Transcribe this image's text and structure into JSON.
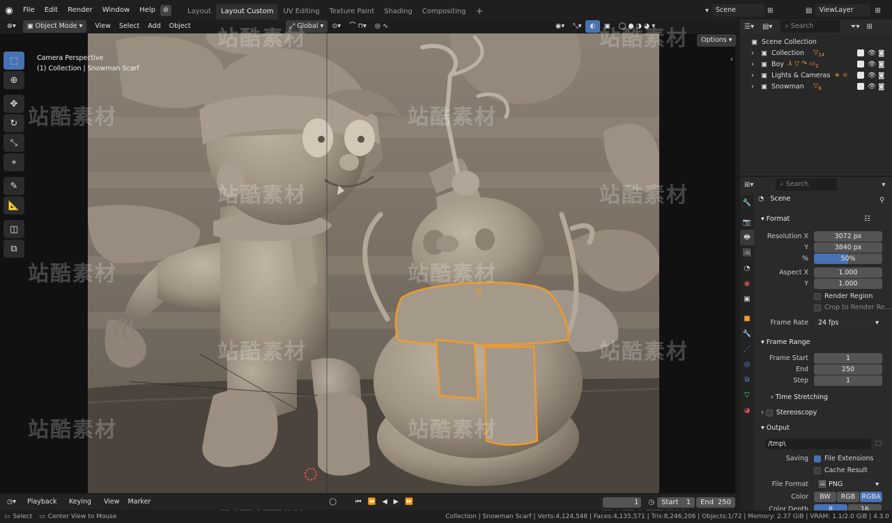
{
  "menu": [
    "File",
    "Edit",
    "Render",
    "Window",
    "Help"
  ],
  "workspaces": [
    {
      "label": "Layout",
      "active": false
    },
    {
      "label": "Layout Custom",
      "active": true
    },
    {
      "label": "UV Editing",
      "active": false
    },
    {
      "label": "Texture Paint",
      "active": false
    },
    {
      "label": "Shading",
      "active": false
    },
    {
      "label": "Compositing",
      "active": false
    }
  ],
  "add_workspace": "+",
  "scene_field": "Scene",
  "viewlayer_field": "ViewLayer",
  "viewport": {
    "mode": "Object Mode",
    "menus": [
      "View",
      "Select",
      "Add",
      "Object"
    ],
    "transform": "Global",
    "options": "Options",
    "camera_line1": "Camera Perspective",
    "camera_line2": "(1) Collection | Snowman Scarf"
  },
  "outliner": {
    "search_placeholder": "Search",
    "root": "Scene Collection",
    "items": [
      {
        "label": "Collection",
        "badge": "14"
      },
      {
        "label": "Boy",
        "badge": "2"
      },
      {
        "label": "Lights & Cameras",
        "badge": ""
      },
      {
        "label": "Snowman",
        "badge": "8"
      }
    ]
  },
  "properties": {
    "search_placeholder": "Search",
    "title": "Scene",
    "format": {
      "header": "Format",
      "res_x_label": "Resolution X",
      "res_x": "3072 px",
      "res_y_label": "Y",
      "res_y": "3840 px",
      "pct_label": "%",
      "pct": "50%",
      "pct_value": 0.5,
      "aspect_x_label": "Aspect X",
      "aspect_x": "1.000",
      "aspect_y_label": "Y",
      "aspect_y": "1.000",
      "render_region": "Render Region",
      "crop": "Crop to Render Re...",
      "frame_rate_label": "Frame Rate",
      "frame_rate": "24 fps"
    },
    "frame_range": {
      "header": "Frame Range",
      "start_label": "Frame Start",
      "start": "1",
      "end_label": "End",
      "end": "250",
      "step_label": "Step",
      "step": "1"
    },
    "time_stretching": "Time Stretching",
    "stereoscopy": "Stereoscopy",
    "output": {
      "header": "Output",
      "path": "/tmp\\",
      "saving_label": "Saving",
      "file_ext": "File Extensions",
      "cache": "Cache Result",
      "file_format_label": "File Format",
      "file_format": "PNG",
      "color_label": "Color",
      "color_opts": [
        "BW",
        "RGB",
        "RGBA"
      ],
      "color_depth_label": "Color Depth",
      "color_depth": [
        "8",
        "16"
      ]
    }
  },
  "timeline": {
    "menus": [
      "Playback",
      "Keying",
      "View",
      "Marker"
    ],
    "current_frame": "1",
    "start_label": "Start",
    "start": "1",
    "end_label": "End",
    "end": "250"
  },
  "status": {
    "select": "Select",
    "center": "Center View to Mouse",
    "info": "Collection | Snowman Scarf | Verts:4,124,548 | Faces:4,135,571 | Tris:8,246,206 | Objects:1/72 | Memory: 2.37 GiB | VRAM: 1.1/2.0 GiB | 4.3.0"
  },
  "watermark": "站酷素材",
  "colors": {
    "accent": "#4772b3",
    "selection": "#f39a27",
    "clay": "#a39888"
  }
}
